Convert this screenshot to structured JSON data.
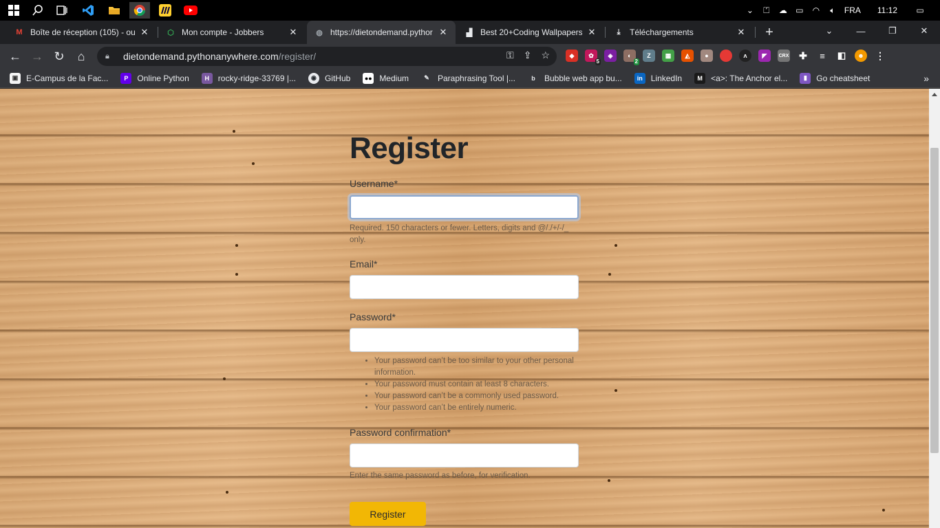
{
  "taskbar": {
    "language": "FRA",
    "time": "11:12",
    "pinned": [
      "windows-start",
      "search",
      "task-view",
      "vscode",
      "file-explorer",
      "chrome",
      "miro",
      "youtube"
    ]
  },
  "tabs": [
    {
      "title": "Boîte de réception (105) - ou",
      "favicon": "M",
      "favicon_color": "#ea4335"
    },
    {
      "title": "Mon compte - Jobbers",
      "favicon": "J",
      "favicon_color": "#34a853"
    },
    {
      "title": "https://dietondemand.pythor",
      "favicon": "◍",
      "favicon_color": "#9aa0a6",
      "active": true
    },
    {
      "title": "Best 20+Coding Wallpapers |",
      "favicon": "▟",
      "favicon_color": "#e8eaed"
    },
    {
      "title": "Téléchargements",
      "favicon": "⤓",
      "favicon_color": "#e8eaed"
    }
  ],
  "window_controls": {
    "minimize": "—",
    "restore": "❐",
    "close": "✕"
  },
  "address_bar": {
    "host": "dietondemand.pythonanywhere.com",
    "path": "/register/"
  },
  "extensions": [
    {
      "name": "ext-red",
      "color": "#d93025",
      "label": "◆"
    },
    {
      "name": "ext-candy",
      "color": "#c2185b",
      "label": "✿",
      "badge": "5"
    },
    {
      "name": "ext-rainbow",
      "color": "#7b1fa2",
      "label": "◈"
    },
    {
      "name": "ext-bug",
      "color": "#8d6e63",
      "label": "◐",
      "badge": "2"
    },
    {
      "name": "ext-z",
      "color": "#607d8b",
      "label": "Z"
    },
    {
      "name": "ext-multi",
      "color": "#43a047",
      "label": "▦"
    },
    {
      "name": "ext-fox",
      "color": "#e65100",
      "label": "◭"
    },
    {
      "name": "ext-cookie",
      "color": "#a1887f",
      "label": "●"
    },
    {
      "name": "ext-ball",
      "color": "#e53935",
      "label": "●"
    },
    {
      "name": "ext-letter",
      "color": "#212121",
      "label": "ᴧ"
    },
    {
      "name": "ext-purple",
      "color": "#9c27b0",
      "label": "◤"
    },
    {
      "name": "ext-crx",
      "color": "#757575",
      "label": "CRX"
    }
  ],
  "bookmarks": [
    {
      "label": "E-Campus de la Fac...",
      "favicon": "▣",
      "color": "#f5f5f5"
    },
    {
      "label": "Online Python",
      "favicon": "P",
      "color": "#6200ea"
    },
    {
      "label": "rocky-ridge-33769 |...",
      "favicon": "H",
      "color": "#79589f"
    },
    {
      "label": "GitHub",
      "favicon": "◉",
      "color": "#24292e"
    },
    {
      "label": "Medium",
      "favicon": "●●",
      "color": "#000000"
    },
    {
      "label": "Paraphrasing Tool |...",
      "favicon": "✎",
      "color": "#5f6368"
    },
    {
      "label": "Bubble web app bu...",
      "favicon": "b",
      "color": "#1a1a1a"
    },
    {
      "label": "LinkedIn",
      "favicon": "in",
      "color": "#0a66c2"
    },
    {
      "label": "<a>: The Anchor el...",
      "favicon": "M",
      "color": "#1a1a1a"
    },
    {
      "label": "Go cheatsheet",
      "favicon": "▮",
      "color": "#7e57c2"
    }
  ],
  "form": {
    "title": "Register",
    "username": {
      "label": "Username*",
      "value": "",
      "help": "Required. 150 characters or fewer. Letters, digits and @/./+/-/_ only."
    },
    "email": {
      "label": "Email*",
      "value": ""
    },
    "password": {
      "label": "Password*",
      "value": "",
      "help_items": [
        "Your password can’t be too similar to your other personal information.",
        "Your password must contain at least 8 characters.",
        "Your password can’t be a commonly used password.",
        "Your password can’t be entirely numeric."
      ]
    },
    "password_confirmation": {
      "label": "Password confirmation*",
      "value": "",
      "help": "Enter the same password as before, for verification."
    },
    "submit_label": "Register"
  }
}
